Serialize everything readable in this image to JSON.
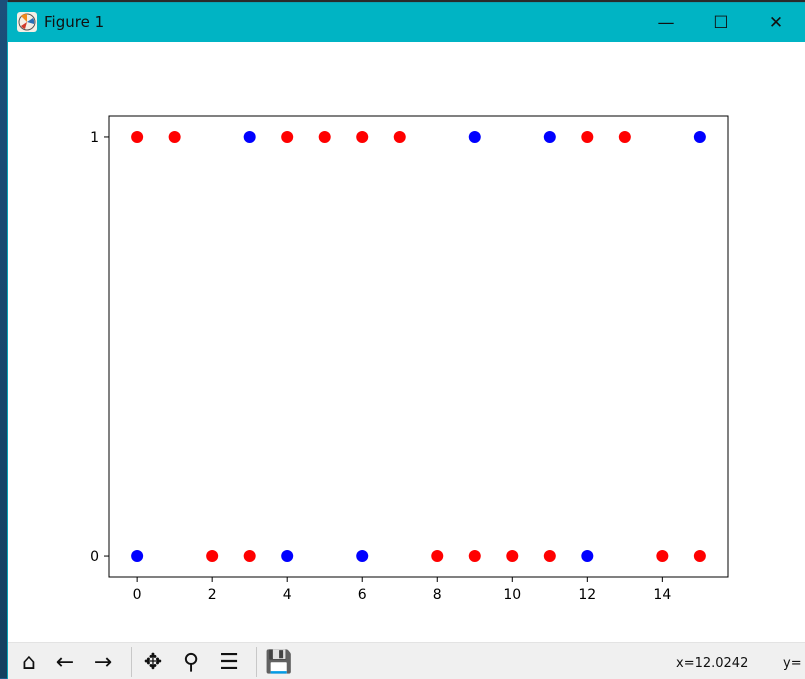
{
  "window": {
    "title": "Figure 1",
    "minimize_glyph": "—",
    "maximize_glyph": "☐",
    "close_glyph": "✕",
    "icon": "matplotlib-figure-icon"
  },
  "toolbar": {
    "buttons": [
      {
        "name": "home-icon",
        "glyph": "⌂"
      },
      {
        "name": "back-arrow-icon",
        "glyph": "←"
      },
      {
        "name": "forward-arrow-icon",
        "glyph": "→"
      },
      {
        "name": "pan-icon",
        "glyph": "✥"
      },
      {
        "name": "zoom-icon",
        "glyph": "⚲"
      },
      {
        "name": "configure-subplots-icon",
        "glyph": "☰"
      },
      {
        "name": "save-icon",
        "glyph": "💾"
      }
    ],
    "coords_x": "x=12.0242",
    "coords_y": "y="
  },
  "chart_data": {
    "type": "scatter",
    "xlim": [
      -0.75,
      15.75
    ],
    "ylim": [
      -0.05,
      1.05
    ],
    "xticks": [
      0,
      2,
      4,
      6,
      8,
      10,
      12,
      14
    ],
    "yticks": [
      0,
      1
    ],
    "colors": {
      "red": "#ff0000",
      "blue": "#0000ff"
    },
    "points": [
      {
        "x": 0,
        "y": 1,
        "color": "red"
      },
      {
        "x": 1,
        "y": 1,
        "color": "red"
      },
      {
        "x": 3,
        "y": 1,
        "color": "blue"
      },
      {
        "x": 4,
        "y": 1,
        "color": "red"
      },
      {
        "x": 5,
        "y": 1,
        "color": "red"
      },
      {
        "x": 6,
        "y": 1,
        "color": "red"
      },
      {
        "x": 7,
        "y": 1,
        "color": "red"
      },
      {
        "x": 9,
        "y": 1,
        "color": "blue"
      },
      {
        "x": 11,
        "y": 1,
        "color": "blue"
      },
      {
        "x": 12,
        "y": 1,
        "color": "red"
      },
      {
        "x": 13,
        "y": 1,
        "color": "red"
      },
      {
        "x": 15,
        "y": 1,
        "color": "blue"
      },
      {
        "x": 0,
        "y": 0,
        "color": "blue"
      },
      {
        "x": 2,
        "y": 0,
        "color": "red"
      },
      {
        "x": 3,
        "y": 0,
        "color": "red"
      },
      {
        "x": 4,
        "y": 0,
        "color": "blue"
      },
      {
        "x": 6,
        "y": 0,
        "color": "blue"
      },
      {
        "x": 8,
        "y": 0,
        "color": "red"
      },
      {
        "x": 9,
        "y": 0,
        "color": "red"
      },
      {
        "x": 10,
        "y": 0,
        "color": "red"
      },
      {
        "x": 11,
        "y": 0,
        "color": "red"
      },
      {
        "x": 12,
        "y": 0,
        "color": "blue"
      },
      {
        "x": 14,
        "y": 0,
        "color": "red"
      },
      {
        "x": 15,
        "y": 0,
        "color": "red"
      }
    ],
    "grid": false,
    "title": "",
    "xlabel": "",
    "ylabel": ""
  }
}
